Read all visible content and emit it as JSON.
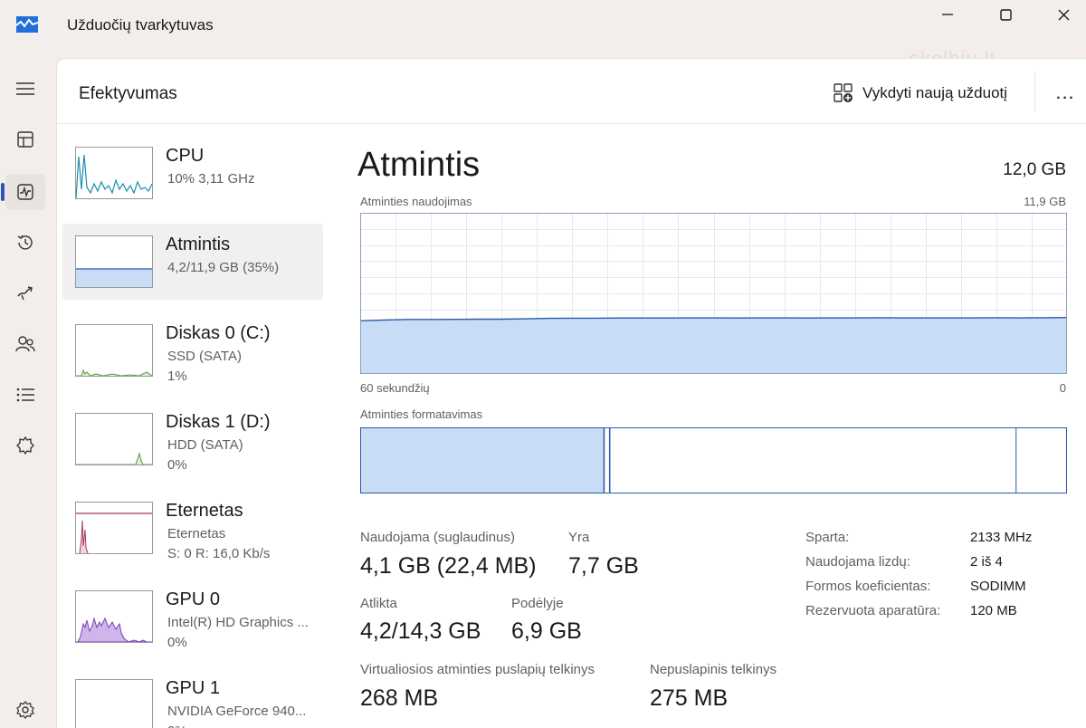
{
  "window": {
    "title": "Užduočių tvarkytuvas",
    "watermark": "skelbiu.lt"
  },
  "nav": {
    "items": [
      {
        "icon": "hamburger-menu-icon"
      },
      {
        "icon": "processes-icon"
      },
      {
        "icon": "performance-icon"
      },
      {
        "icon": "app-history-icon"
      },
      {
        "icon": "startup-apps-icon"
      },
      {
        "icon": "users-icon"
      },
      {
        "icon": "details-icon"
      },
      {
        "icon": "services-icon"
      },
      {
        "icon": "settings-icon"
      }
    ],
    "active": "performance-icon"
  },
  "header": {
    "title": "Efektyvumas",
    "run_task_label": "Vykdyti naują užduotį",
    "more_label": "..."
  },
  "devices": [
    {
      "name": "CPU",
      "line2": "10% 3,11 GHz",
      "line3": ""
    },
    {
      "name": "Atmintis",
      "line2": "4,2/11,9 GB (35%)",
      "line3": ""
    },
    {
      "name": "Diskas 0 (C:)",
      "line2": "SSD (SATA)",
      "line3": "1%"
    },
    {
      "name": "Diskas 1 (D:)",
      "line2": "HDD (SATA)",
      "line3": "0%"
    },
    {
      "name": "Eternetas",
      "line2": "Eternetas",
      "line3": "S: 0 R: 16,0 Kb/s"
    },
    {
      "name": "GPU 0",
      "line2": "Intel(R) HD Graphics ...",
      "line3": "0%"
    },
    {
      "name": "GPU 1",
      "line2": "NVIDIA GeForce 940...",
      "line3": "0%"
    }
  ],
  "selected_device": "Atmintis",
  "detail": {
    "title": "Atmintis",
    "total": "12,0 GB",
    "usage_label": "Atminties naudojimas",
    "usage_max": "11,9 GB",
    "axis_left": "60 sekundžių",
    "axis_right": "0",
    "composition_label": "Atminties formatavimas",
    "composition": {
      "in_use_fraction": 0.345,
      "modified_fraction": 0.008,
      "standby_fraction": 0.575,
      "free_fraction": 0.072
    }
  },
  "stats": {
    "in_use": {
      "label": "Naudojama (suglaudinus)",
      "value": "4,1 GB (22,4 MB)"
    },
    "available": {
      "label": "Yra",
      "value": "7,7 GB"
    },
    "committed": {
      "label": "Atlikta",
      "value": "4,2/14,3 GB"
    },
    "cached": {
      "label": "Podėlyje",
      "value": "6,9 GB"
    },
    "paged_pool": {
      "label": "Virtualiosios atminties puslapių telkinys",
      "value": "268 MB"
    },
    "nonpaged_pool": {
      "label": "Nepuslapinis telkinys",
      "value": "275 MB"
    }
  },
  "specs": [
    {
      "key": "Sparta:",
      "value": "2133 MHz"
    },
    {
      "key": "Naudojama lizdų:",
      "value": "2 iš 4"
    },
    {
      "key": "Formos koeficientas:",
      "value": "SODIMM"
    },
    {
      "key": "Rezervuota aparatūra:",
      "value": "120 MB"
    }
  ],
  "memory_usage_series": [
    0.33,
    0.335,
    0.338,
    0.338,
    0.339,
    0.34,
    0.34,
    0.342,
    0.345,
    0.346,
    0.346,
    0.347,
    0.347,
    0.347,
    0.348,
    0.348,
    0.347,
    0.348,
    0.348,
    0.347,
    0.348,
    0.348,
    0.349,
    0.348,
    0.348,
    0.348,
    0.348,
    0.349,
    0.348,
    0.349,
    0.35
  ],
  "colors": {
    "memory_fill": "#c9dcf5",
    "memory_line": "#2b5aa8",
    "cpu_line": "#1a8fb0",
    "disk_line": "#5da04a",
    "ethernet_line": "#a23a5e",
    "gpu_fill": "#cdb6ea",
    "gpu_line": "#7a3fb8",
    "active_indicator": "#2a55b8"
  }
}
